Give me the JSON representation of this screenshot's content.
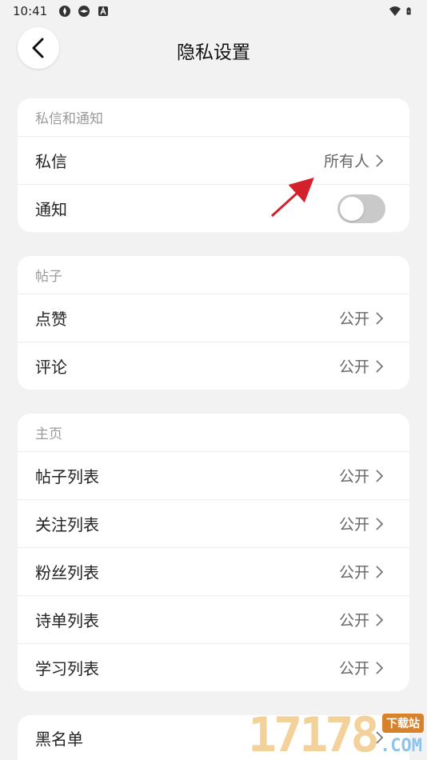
{
  "status_bar": {
    "time": "10:41",
    "left_icons": [
      "app-icon",
      "app-icon",
      "notification-a-icon"
    ],
    "right_icons": [
      "wifi-icon",
      "battery-icon"
    ]
  },
  "header": {
    "back_icon": "chevron-left-icon",
    "title": "隐私设置"
  },
  "sections": {
    "messages": {
      "title": "私信和通知",
      "dm_label": "私信",
      "dm_value": "所有人",
      "notify_label": "通知",
      "notify_on": false
    },
    "posts": {
      "title": "帖子",
      "like_label": "点赞",
      "like_value": "公开",
      "comment_label": "评论",
      "comment_value": "公开"
    },
    "homepage": {
      "title": "主页",
      "items": [
        {
          "label": "帖子列表",
          "value": "公开"
        },
        {
          "label": "关注列表",
          "value": "公开"
        },
        {
          "label": "粉丝列表",
          "value": "公开"
        },
        {
          "label": "诗单列表",
          "value": "公开"
        },
        {
          "label": "学习列表",
          "value": "公开"
        }
      ]
    },
    "blacklist": {
      "label": "黑名单"
    }
  },
  "watermark": {
    "digits": "17178",
    "badge": "下载站",
    "suffix": ".COM"
  },
  "colors": {
    "background": "#f2f2f2",
    "card": "#ffffff",
    "toggle_off": "#c9c9c9",
    "annotation": "#d4202a"
  }
}
